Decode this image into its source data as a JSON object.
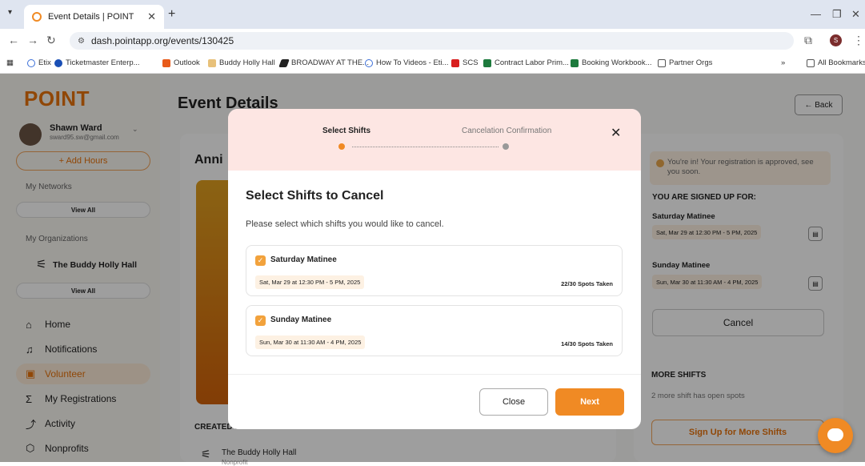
{
  "browser": {
    "tab_title": "Event Details | POINT",
    "url": "dash.pointapp.org/events/130425",
    "bookmarks": [
      "Etix",
      "Ticketmaster Enterp...",
      "Outlook",
      "Buddy Holly Hall",
      "BROADWAY AT THE...",
      "How To Videos - Eti...",
      "SCS",
      "Contract Labor Prim...",
      "Booking Workbook...",
      "Partner Orgs"
    ],
    "all_bookmarks": "All Bookmarks",
    "profile_initial": "S"
  },
  "sidebar": {
    "logo": "POINT",
    "user_name": "Shawn Ward",
    "user_email": "sward95.sw@gmail.com",
    "add_hours": "+ Add Hours",
    "my_networks": "My Networks",
    "view_all": "View All",
    "my_organizations": "My Organizations",
    "org_name": "The Buddy Holly Hall",
    "nav": [
      "Home",
      "Notifications",
      "Volunteer",
      "My Registrations",
      "Activity",
      "Nonprofits"
    ]
  },
  "main": {
    "title": "Event Details",
    "back": "← Back",
    "card_title": "Anni",
    "created_by": "CREATED BY",
    "creator_name": "The Buddy Holly Hall",
    "creator_type": "Nonprofit"
  },
  "right_panel": {
    "approved": "You're in! Your registration is approved, see you soon.",
    "signed_up_heading": "YOU ARE SIGNED UP FOR:",
    "shifts": [
      {
        "name": "Saturday Matinee",
        "date": "Sat, Mar 29 at 12:30 PM - 5 PM, 2025"
      },
      {
        "name": "Sunday Matinee",
        "date": "Sun, Mar 30 at 11:30 AM - 4 PM, 2025"
      }
    ],
    "cancel": "Cancel",
    "more_shifts": "MORE SHIFTS",
    "more_shifts_text": "2 more shift has open spots",
    "sign_up_more": "Sign Up for More Shifts"
  },
  "modal": {
    "step1": "Select Shifts",
    "step2": "Cancelation Confirmation",
    "title": "Select Shifts to Cancel",
    "instructions": "Please select which shifts you would like to cancel.",
    "shifts": [
      {
        "name": "Saturday Matinee",
        "date": "Sat, Mar 29 at 12:30 PM - 5 PM, 2025",
        "spots": "22/30 Spots Taken",
        "checked": true
      },
      {
        "name": "Sunday Matinee",
        "date": "Sun, Mar 30 at 11:30 AM - 4 PM, 2025",
        "spots": "14/30 Spots Taken",
        "checked": true
      }
    ],
    "close": "Close",
    "next": "Next"
  },
  "colors": {
    "accent": "#f08a24",
    "modal_header": "#fde6e3"
  },
  "icons": [
    "tab-favicon-icon",
    "close-icon",
    "back-arrow-icon",
    "reload-icon",
    "star-icon",
    "extensions-icon",
    "home-icon",
    "bell-icon",
    "calendar-icon",
    "registrations-icon",
    "activity-icon",
    "nonprofits-icon",
    "checkbox-checked-icon",
    "chat-icon"
  ]
}
